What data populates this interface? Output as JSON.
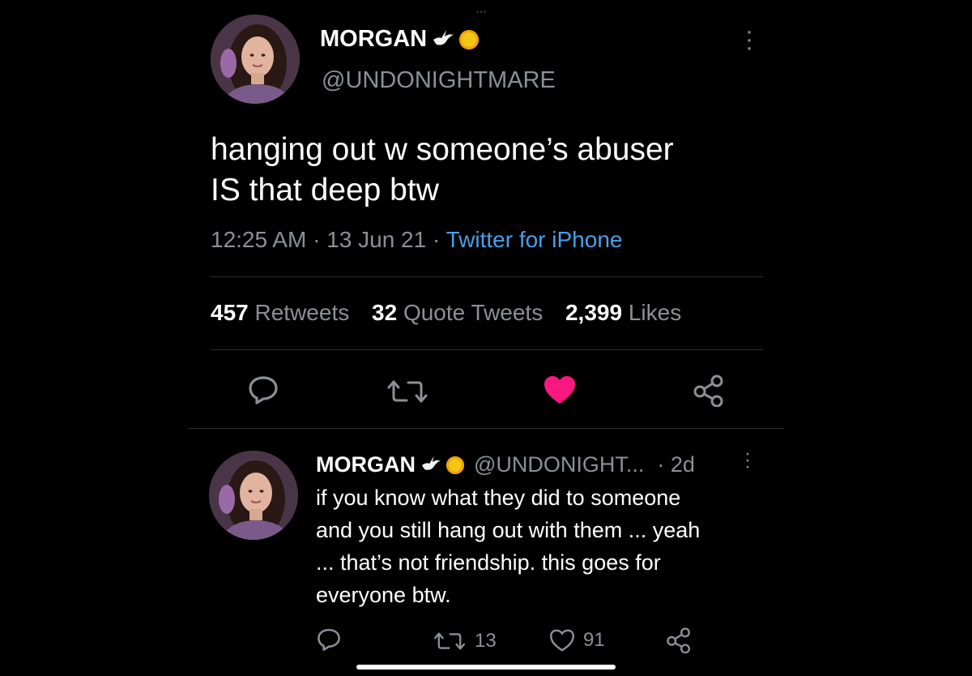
{
  "tweet": {
    "display_name": "MORGAN",
    "handle": "@UNDONIGHTMARE",
    "text_line1": "hanging out w someone’s abuser",
    "text_line2": "IS that deep btw",
    "time": "12:25 AM",
    "date": "13 Jun 21",
    "separator": "·",
    "source": "Twitter for iPhone",
    "stats": {
      "retweets_count": "457",
      "retweets_label": "Retweets",
      "quotes_count": "32",
      "quotes_label": "Quote Tweets",
      "likes_count": "2,399",
      "likes_label": "Likes"
    }
  },
  "reply": {
    "display_name": "MORGAN",
    "handle": "@UNDONIGHT...",
    "time": "· 2d",
    "text_line1": "if you know what they did to someone",
    "text_line2": "and you still hang out with them ... yeah",
    "text_line3": "... that’s not friendship. this goes for",
    "text_line4": "everyone btw.",
    "retweet_count": "13",
    "like_count": "91"
  },
  "icons": {
    "name_emoji_1": "dove-icon",
    "name_emoji_2": "sun-icon",
    "reply": "reply-icon",
    "retweet": "retweet-icon",
    "like": "heart-icon",
    "share": "share-icon",
    "more": "more-vertical-icon"
  },
  "colors": {
    "background": "#000000",
    "primary_text": "#ffffff",
    "secondary_text": "#8b9096",
    "link": "#4a9eeb",
    "like_active": "#f91880"
  }
}
